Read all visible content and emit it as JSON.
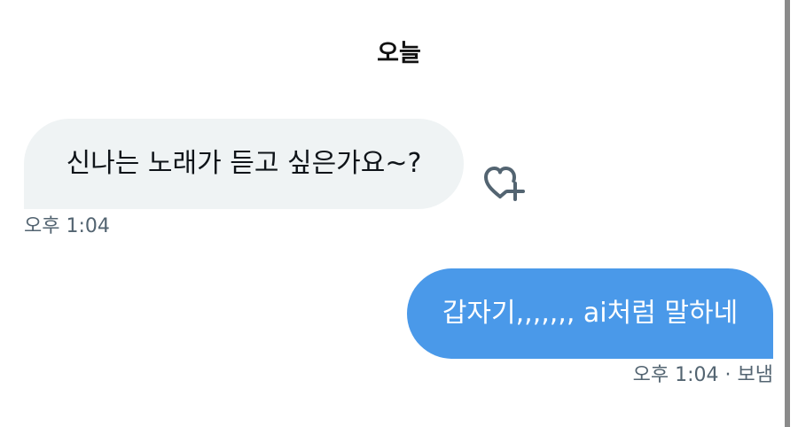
{
  "date_header": "오늘",
  "messages": [
    {
      "direction": "received",
      "text": "신나는 노래가 듣고 싶은가요~?",
      "time": "오후 1:04"
    },
    {
      "direction": "sent",
      "text": "갑자기,,,,,,, ai처럼 말하네",
      "time": "오후 1:04",
      "status": "보냄"
    }
  ],
  "icons": {
    "reaction": "heart-plus-icon"
  },
  "colors": {
    "sent_bubble": "#4a99e9",
    "received_bubble": "#eff3f4",
    "meta_text": "#536471"
  }
}
